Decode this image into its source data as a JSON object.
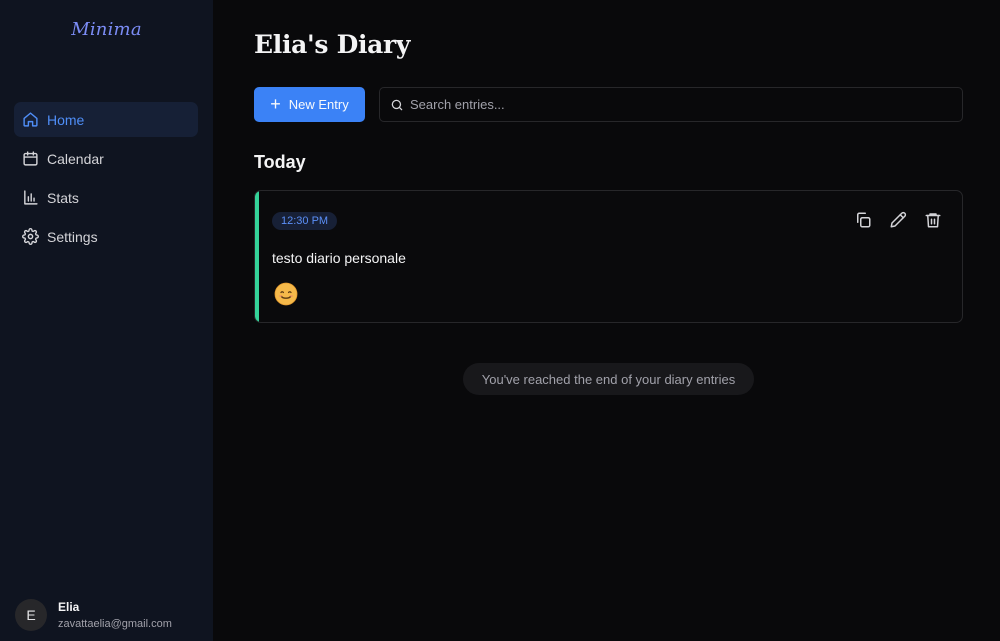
{
  "sidebar": {
    "brand": "Minima",
    "items": [
      {
        "label": "Home",
        "icon": "home-icon",
        "active": true
      },
      {
        "label": "Calendar",
        "icon": "calendar-icon",
        "active": false
      },
      {
        "label": "Stats",
        "icon": "bar-chart-icon",
        "active": false
      },
      {
        "label": "Settings",
        "icon": "gear-icon",
        "active": false
      }
    ],
    "user": {
      "initial": "E",
      "name": "Elia",
      "email": "zavattaelia@gmail.com"
    }
  },
  "main": {
    "title": "Elia's Diary",
    "new_entry_label": "New Entry",
    "search_placeholder": "Search entries...",
    "section_title": "Today",
    "entries": [
      {
        "time": "12:30 PM",
        "text": "testo diario personale",
        "mood_icon": "smiling-face-icon"
      }
    ],
    "end_message": "You've reached the end of your diary entries"
  },
  "colors": {
    "accent": "#3b82f6",
    "entry_bar": "#34d399",
    "sidebar_bg": "#0f1420",
    "main_bg": "#09090b"
  }
}
